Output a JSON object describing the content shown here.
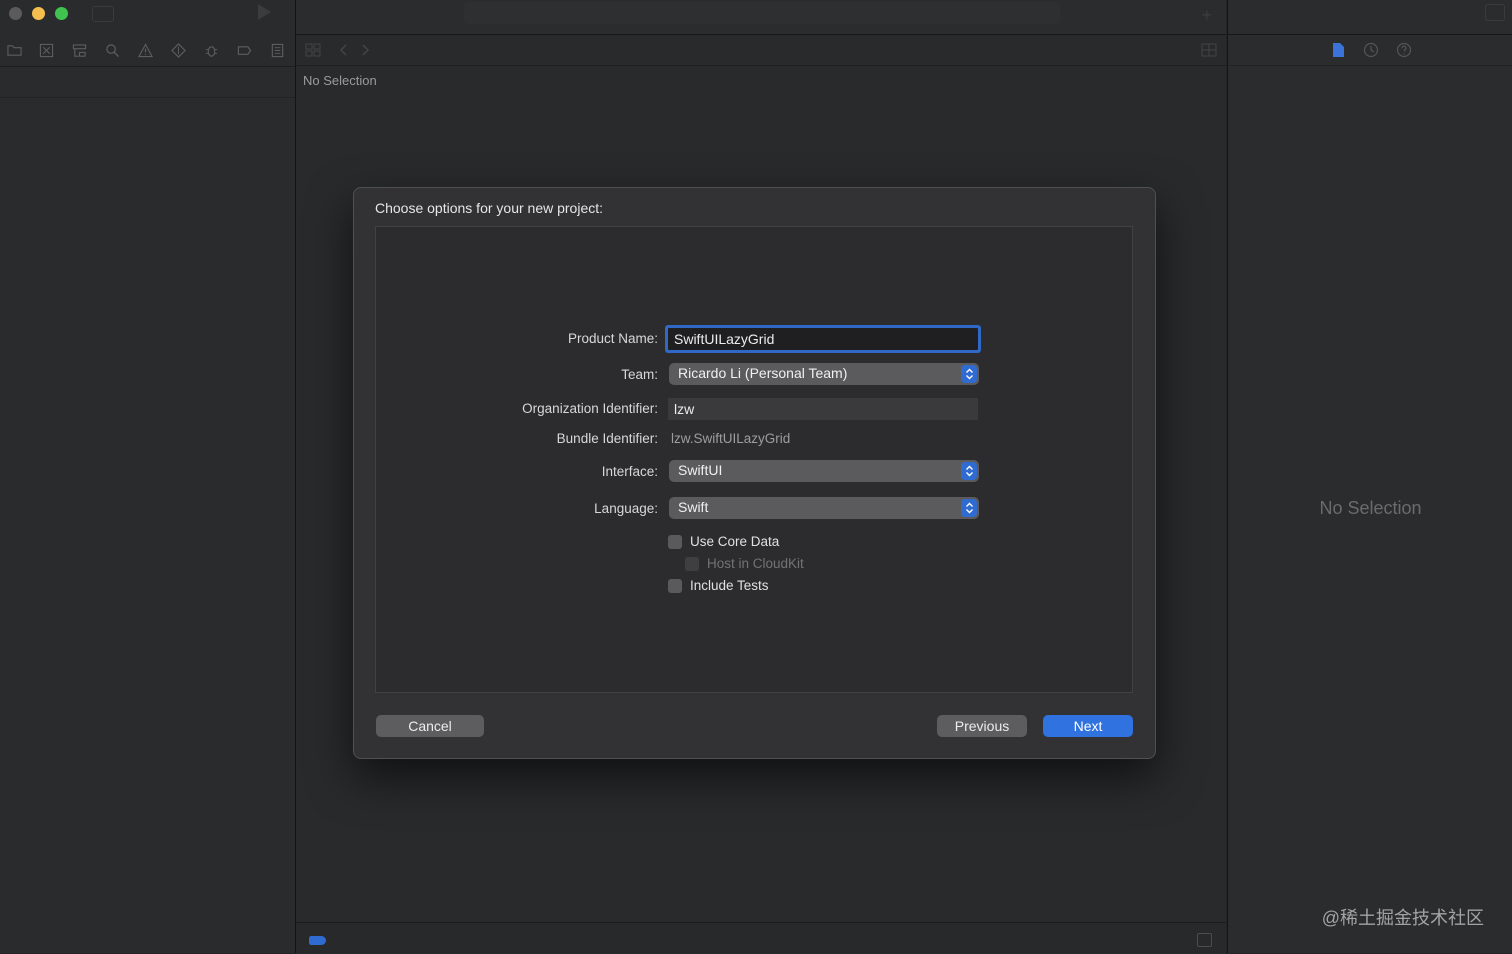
{
  "editor": {
    "no_selection": "No Selection"
  },
  "inspector": {
    "no_selection": "No Selection"
  },
  "watermark": "@稀土掘金技术社区",
  "dialog": {
    "title": "Choose options for your new project:",
    "fields": {
      "product_name": {
        "label": "Product Name:",
        "value": "SwiftUILazyGrid"
      },
      "team": {
        "label": "Team:",
        "value": "Ricardo Li (Personal Team)"
      },
      "org_identifier": {
        "label": "Organization Identifier:",
        "value": "lzw"
      },
      "bundle_identifier": {
        "label": "Bundle Identifier:",
        "value": "lzw.SwiftUILazyGrid"
      },
      "interface": {
        "label": "Interface:",
        "value": "SwiftUI"
      },
      "language": {
        "label": "Language:",
        "value": "Swift"
      }
    },
    "checkboxes": {
      "use_core_data": {
        "label": "Use Core Data",
        "checked": false
      },
      "host_in_cloudkit": {
        "label": "Host in CloudKit",
        "checked": false,
        "enabled": false
      },
      "include_tests": {
        "label": "Include Tests",
        "checked": false
      }
    },
    "buttons": {
      "cancel": "Cancel",
      "previous": "Previous",
      "next": "Next"
    }
  },
  "colors": {
    "accent": "#2f72e0",
    "focus_ring": "#2f69c5"
  }
}
